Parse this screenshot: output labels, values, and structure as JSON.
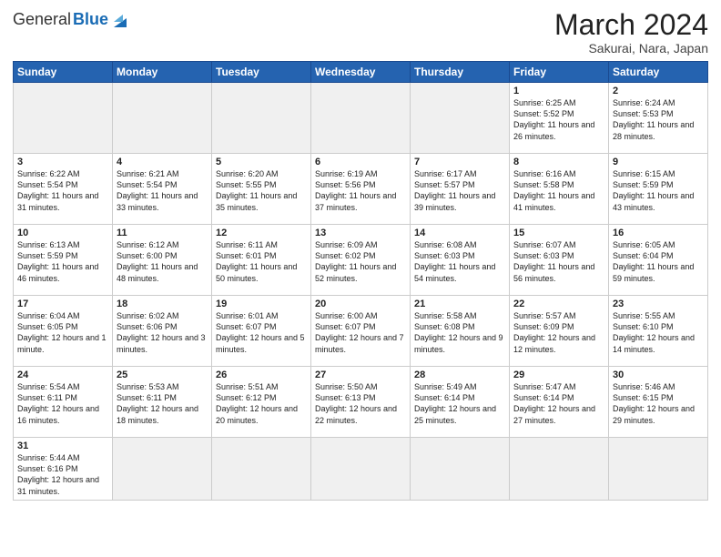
{
  "header": {
    "logo_general": "General",
    "logo_blue": "Blue",
    "month_title": "March 2024",
    "subtitle": "Sakurai, Nara, Japan"
  },
  "weekdays": [
    "Sunday",
    "Monday",
    "Tuesday",
    "Wednesday",
    "Thursday",
    "Friday",
    "Saturday"
  ],
  "weeks": [
    [
      {
        "day": "",
        "info": "",
        "empty": true
      },
      {
        "day": "",
        "info": "",
        "empty": true
      },
      {
        "day": "",
        "info": "",
        "empty": true
      },
      {
        "day": "",
        "info": "",
        "empty": true
      },
      {
        "day": "",
        "info": "",
        "empty": true
      },
      {
        "day": "1",
        "info": "Sunrise: 6:25 AM\nSunset: 5:52 PM\nDaylight: 11 hours\nand 26 minutes.",
        "empty": false
      },
      {
        "day": "2",
        "info": "Sunrise: 6:24 AM\nSunset: 5:53 PM\nDaylight: 11 hours\nand 28 minutes.",
        "empty": false
      }
    ],
    [
      {
        "day": "3",
        "info": "Sunrise: 6:22 AM\nSunset: 5:54 PM\nDaylight: 11 hours\nand 31 minutes.",
        "empty": false
      },
      {
        "day": "4",
        "info": "Sunrise: 6:21 AM\nSunset: 5:54 PM\nDaylight: 11 hours\nand 33 minutes.",
        "empty": false
      },
      {
        "day": "5",
        "info": "Sunrise: 6:20 AM\nSunset: 5:55 PM\nDaylight: 11 hours\nand 35 minutes.",
        "empty": false
      },
      {
        "day": "6",
        "info": "Sunrise: 6:19 AM\nSunset: 5:56 PM\nDaylight: 11 hours\nand 37 minutes.",
        "empty": false
      },
      {
        "day": "7",
        "info": "Sunrise: 6:17 AM\nSunset: 5:57 PM\nDaylight: 11 hours\nand 39 minutes.",
        "empty": false
      },
      {
        "day": "8",
        "info": "Sunrise: 6:16 AM\nSunset: 5:58 PM\nDaylight: 11 hours\nand 41 minutes.",
        "empty": false
      },
      {
        "day": "9",
        "info": "Sunrise: 6:15 AM\nSunset: 5:59 PM\nDaylight: 11 hours\nand 43 minutes.",
        "empty": false
      }
    ],
    [
      {
        "day": "10",
        "info": "Sunrise: 6:13 AM\nSunset: 5:59 PM\nDaylight: 11 hours\nand 46 minutes.",
        "empty": false
      },
      {
        "day": "11",
        "info": "Sunrise: 6:12 AM\nSunset: 6:00 PM\nDaylight: 11 hours\nand 48 minutes.",
        "empty": false
      },
      {
        "day": "12",
        "info": "Sunrise: 6:11 AM\nSunset: 6:01 PM\nDaylight: 11 hours\nand 50 minutes.",
        "empty": false
      },
      {
        "day": "13",
        "info": "Sunrise: 6:09 AM\nSunset: 6:02 PM\nDaylight: 11 hours\nand 52 minutes.",
        "empty": false
      },
      {
        "day": "14",
        "info": "Sunrise: 6:08 AM\nSunset: 6:03 PM\nDaylight: 11 hours\nand 54 minutes.",
        "empty": false
      },
      {
        "day": "15",
        "info": "Sunrise: 6:07 AM\nSunset: 6:03 PM\nDaylight: 11 hours\nand 56 minutes.",
        "empty": false
      },
      {
        "day": "16",
        "info": "Sunrise: 6:05 AM\nSunset: 6:04 PM\nDaylight: 11 hours\nand 59 minutes.",
        "empty": false
      }
    ],
    [
      {
        "day": "17",
        "info": "Sunrise: 6:04 AM\nSunset: 6:05 PM\nDaylight: 12 hours\nand 1 minute.",
        "empty": false
      },
      {
        "day": "18",
        "info": "Sunrise: 6:02 AM\nSunset: 6:06 PM\nDaylight: 12 hours\nand 3 minutes.",
        "empty": false
      },
      {
        "day": "19",
        "info": "Sunrise: 6:01 AM\nSunset: 6:07 PM\nDaylight: 12 hours\nand 5 minutes.",
        "empty": false
      },
      {
        "day": "20",
        "info": "Sunrise: 6:00 AM\nSunset: 6:07 PM\nDaylight: 12 hours\nand 7 minutes.",
        "empty": false
      },
      {
        "day": "21",
        "info": "Sunrise: 5:58 AM\nSunset: 6:08 PM\nDaylight: 12 hours\nand 9 minutes.",
        "empty": false
      },
      {
        "day": "22",
        "info": "Sunrise: 5:57 AM\nSunset: 6:09 PM\nDaylight: 12 hours\nand 12 minutes.",
        "empty": false
      },
      {
        "day": "23",
        "info": "Sunrise: 5:55 AM\nSunset: 6:10 PM\nDaylight: 12 hours\nand 14 minutes.",
        "empty": false
      }
    ],
    [
      {
        "day": "24",
        "info": "Sunrise: 5:54 AM\nSunset: 6:11 PM\nDaylight: 12 hours\nand 16 minutes.",
        "empty": false
      },
      {
        "day": "25",
        "info": "Sunrise: 5:53 AM\nSunset: 6:11 PM\nDaylight: 12 hours\nand 18 minutes.",
        "empty": false
      },
      {
        "day": "26",
        "info": "Sunrise: 5:51 AM\nSunset: 6:12 PM\nDaylight: 12 hours\nand 20 minutes.",
        "empty": false
      },
      {
        "day": "27",
        "info": "Sunrise: 5:50 AM\nSunset: 6:13 PM\nDaylight: 12 hours\nand 22 minutes.",
        "empty": false
      },
      {
        "day": "28",
        "info": "Sunrise: 5:49 AM\nSunset: 6:14 PM\nDaylight: 12 hours\nand 25 minutes.",
        "empty": false
      },
      {
        "day": "29",
        "info": "Sunrise: 5:47 AM\nSunset: 6:14 PM\nDaylight: 12 hours\nand 27 minutes.",
        "empty": false
      },
      {
        "day": "30",
        "info": "Sunrise: 5:46 AM\nSunset: 6:15 PM\nDaylight: 12 hours\nand 29 minutes.",
        "empty": false
      }
    ],
    [
      {
        "day": "31",
        "info": "Sunrise: 5:44 AM\nSunset: 6:16 PM\nDaylight: 12 hours\nand 31 minutes.",
        "empty": false
      },
      {
        "day": "",
        "info": "",
        "empty": true
      },
      {
        "day": "",
        "info": "",
        "empty": true
      },
      {
        "day": "",
        "info": "",
        "empty": true
      },
      {
        "day": "",
        "info": "",
        "empty": true
      },
      {
        "day": "",
        "info": "",
        "empty": true
      },
      {
        "day": "",
        "info": "",
        "empty": true
      }
    ]
  ]
}
